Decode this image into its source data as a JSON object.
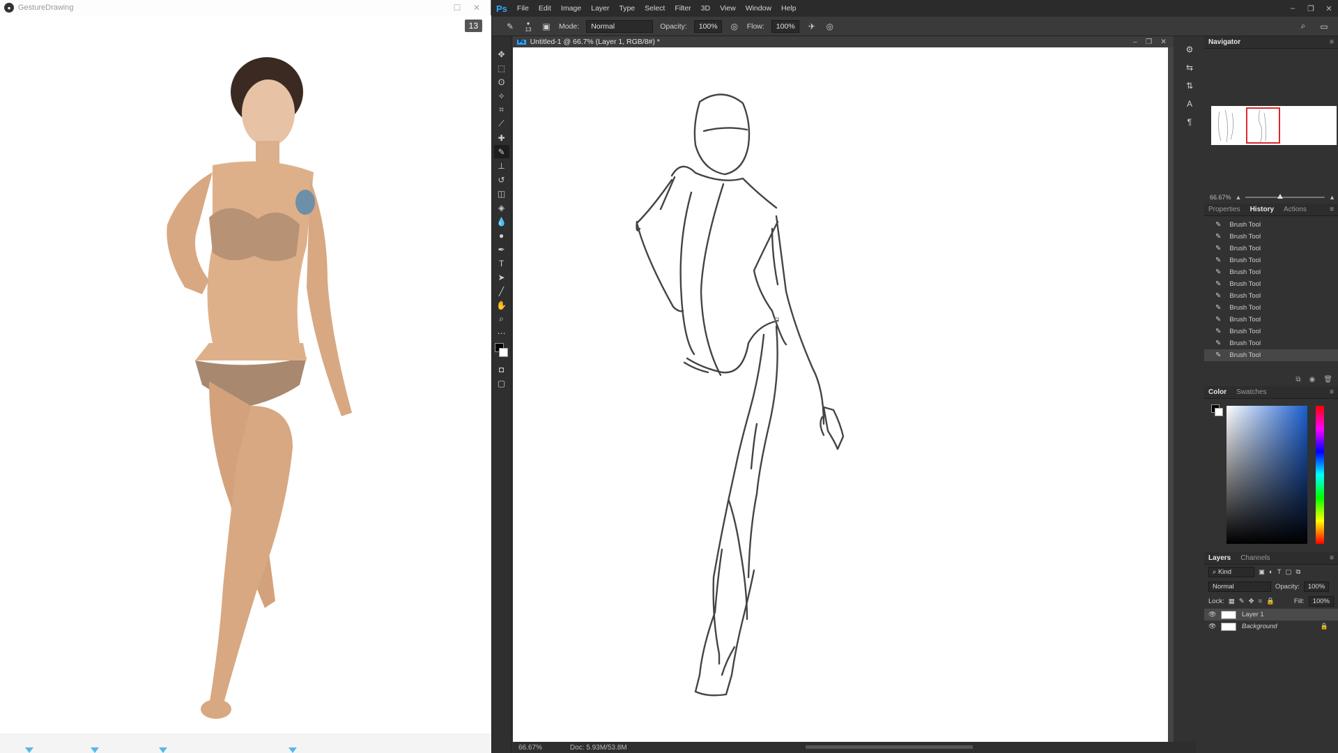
{
  "ref_window": {
    "title": "GestureDrawing",
    "timer": "13"
  },
  "photoshop": {
    "logo": "Ps",
    "menu": [
      "File",
      "Edit",
      "Image",
      "Layer",
      "Type",
      "Select",
      "Filter",
      "3D",
      "View",
      "Window",
      "Help"
    ],
    "options": {
      "brush_size": "13",
      "mode_label": "Mode:",
      "mode_value": "Normal",
      "opacity_label": "Opacity:",
      "opacity_value": "100%",
      "flow_label": "Flow:",
      "flow_value": "100%"
    },
    "document_tab": "Untitled-1 @ 66.7% (Layer 1, RGB/8#) *",
    "status": {
      "zoom": "66.67%",
      "doc": "Doc: 5.93M/53.8M"
    },
    "navigator": {
      "title": "Navigator",
      "zoom": "66.67%"
    },
    "history_panel": {
      "tabs": [
        "Properties",
        "History",
        "Actions"
      ],
      "active_tab": "History",
      "items": [
        "Brush Tool",
        "Brush Tool",
        "Brush Tool",
        "Brush Tool",
        "Brush Tool",
        "Brush Tool",
        "Brush Tool",
        "Brush Tool",
        "Brush Tool",
        "Brush Tool",
        "Brush Tool",
        "Brush Tool"
      ]
    },
    "color_panel": {
      "tabs": [
        "Color",
        "Swatches"
      ],
      "active_tab": "Color",
      "foreground": "#000000",
      "background": "#ffffff"
    },
    "layers_panel": {
      "tabs": [
        "Layers",
        "Channels"
      ],
      "active_tab": "Layers",
      "filter": "Kind",
      "blend_mode": "Normal",
      "opacity_label": "Opacity:",
      "opacity_value": "100%",
      "lock_label": "Lock:",
      "fill_label": "Fill:",
      "fill_value": "100%",
      "layers": [
        {
          "name": "Layer 1",
          "selected": true
        },
        {
          "name": "Background",
          "selected": false
        }
      ]
    }
  }
}
